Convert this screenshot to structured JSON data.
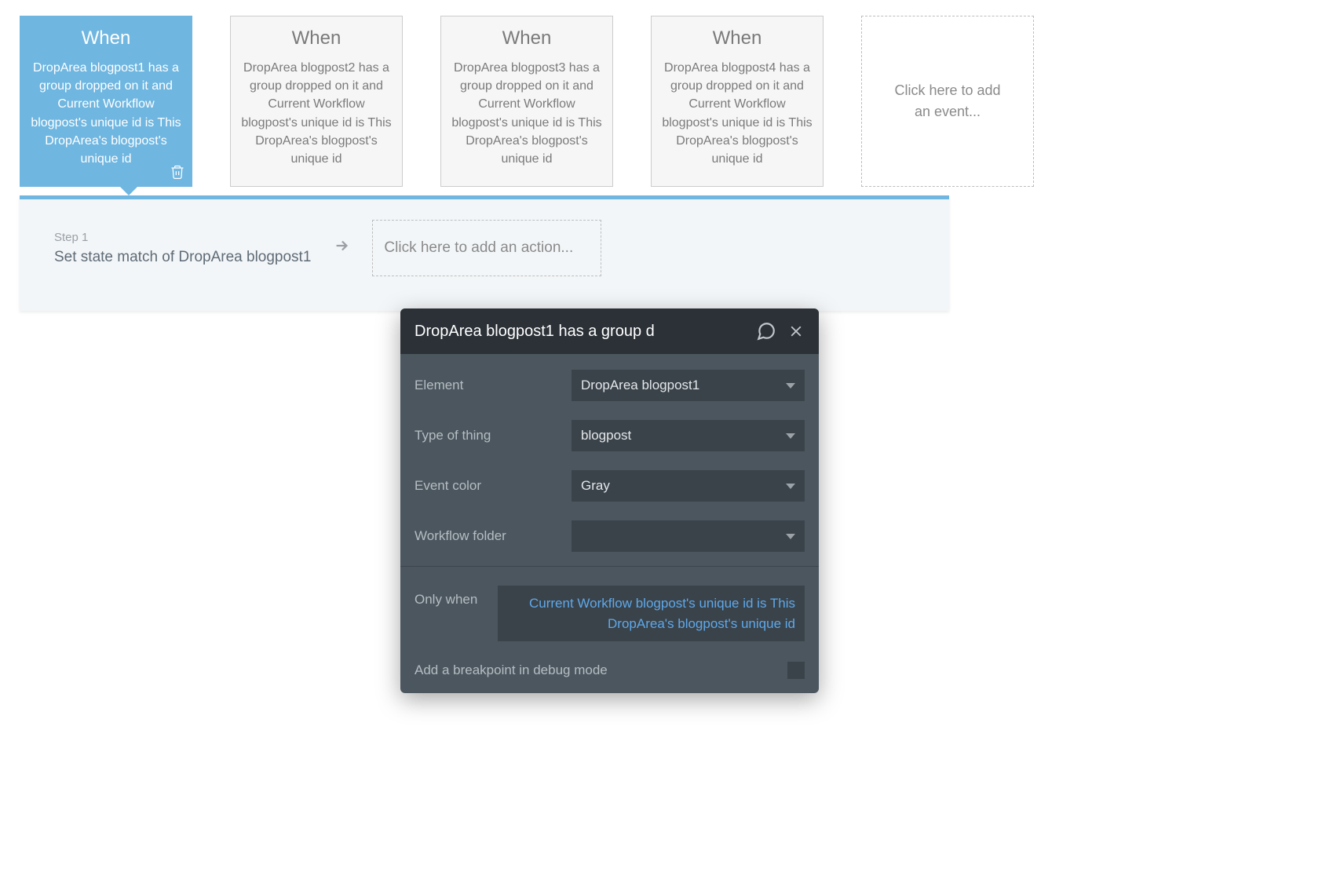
{
  "events": [
    {
      "when_label": "When",
      "body": "DropArea blogpost1 has a group dropped on it and Current Workflow blogpost's unique id is This DropArea's blogpost's unique id"
    },
    {
      "when_label": "When",
      "body": "DropArea blogpost2 has a group dropped on it and Current Workflow blogpost's unique id is This DropArea's blogpost's unique id"
    },
    {
      "when_label": "When",
      "body": "DropArea blogpost3 has a group dropped on it and Current Workflow blogpost's unique id is This DropArea's blogpost's unique id"
    },
    {
      "when_label": "When",
      "body": "DropArea blogpost4 has a group dropped on it and Current Workflow blogpost's unique id is This DropArea's blogpost's unique id"
    }
  ],
  "add_event_label": "Click here to add an event...",
  "step": {
    "label": "Step 1",
    "title": "Set state match of DropArea blogpost1"
  },
  "add_action_label": "Click here to add an action...",
  "panel": {
    "title": "DropArea blogpost1 has a group d",
    "fields": {
      "element_label": "Element",
      "element_value": "DropArea blogpost1",
      "thing_label": "Type of thing",
      "thing_value": "blogpost",
      "color_label": "Event color",
      "color_value": "Gray",
      "folder_label": "Workflow folder",
      "folder_value": ""
    },
    "only_when_label": "Only when",
    "only_when_value": "Current Workflow blogpost's unique id is This DropArea's blogpost's unique id",
    "breakpoint_label": "Add a breakpoint in debug mode"
  }
}
